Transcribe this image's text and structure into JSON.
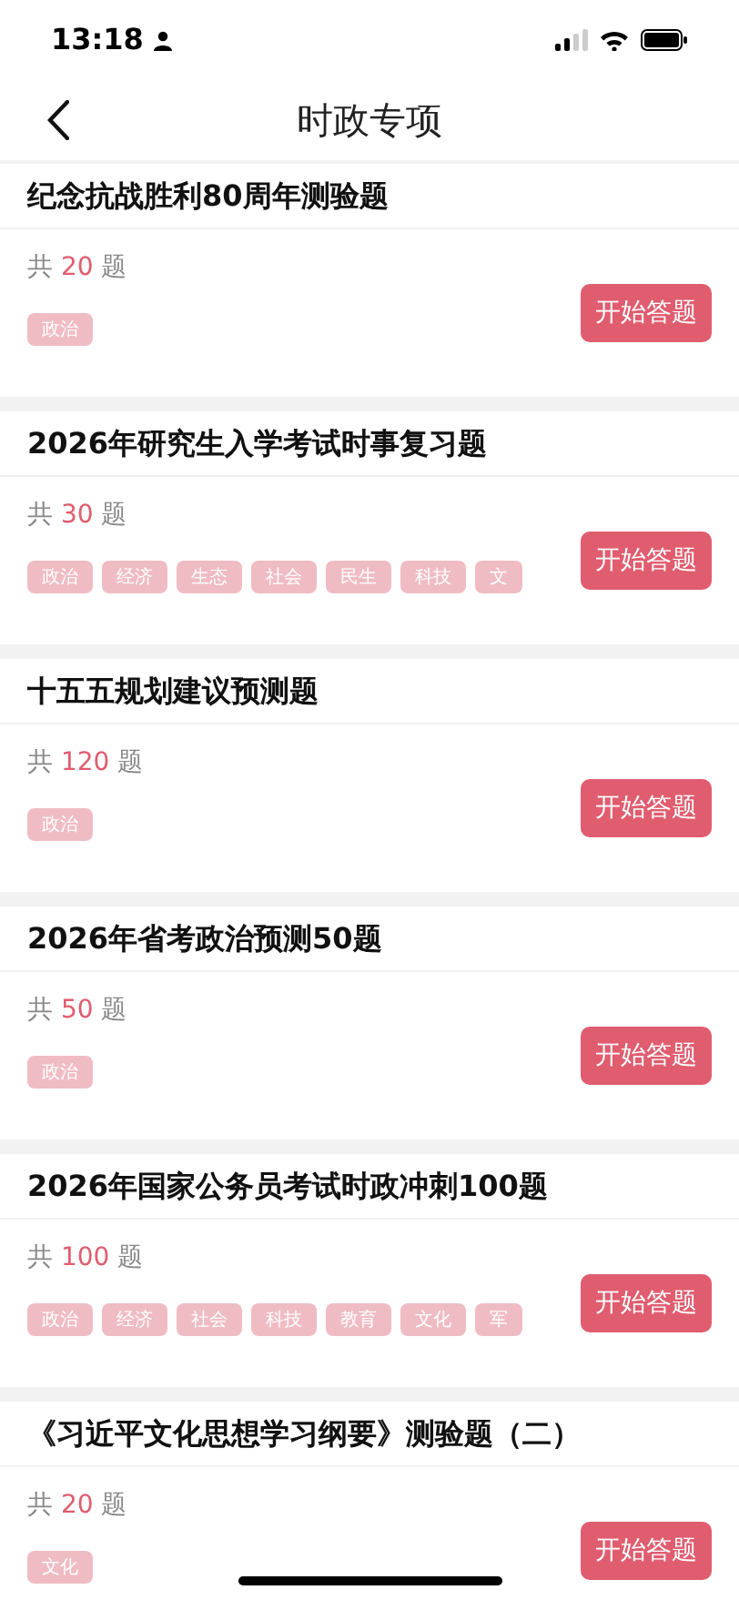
{
  "status_bar": {
    "time": "13:18"
  },
  "nav": {
    "title": "时政专项"
  },
  "quizzes": [
    {
      "title": "纪念抗战胜利80周年测验题",
      "count_prefix": "共",
      "count": "20",
      "count_suffix": "题",
      "tags": [
        "政治"
      ],
      "button": "开始答题"
    },
    {
      "title": "2026年研究生入学考试时事复习题",
      "count_prefix": "共",
      "count": "30",
      "count_suffix": "题",
      "tags": [
        "政治",
        "经济",
        "生态",
        "社会",
        "民生",
        "科技",
        "文"
      ],
      "button": "开始答题"
    },
    {
      "title": "十五五规划建议预测题",
      "count_prefix": "共",
      "count": "120",
      "count_suffix": "题",
      "tags": [
        "政治"
      ],
      "button": "开始答题"
    },
    {
      "title": "2026年省考政治预测50题",
      "count_prefix": "共",
      "count": "50",
      "count_suffix": "题",
      "tags": [
        "政治"
      ],
      "button": "开始答题"
    },
    {
      "title": "2026年国家公务员考试时政冲刺100题",
      "count_prefix": "共",
      "count": "100",
      "count_suffix": "题",
      "tags": [
        "政治",
        "经济",
        "社会",
        "科技",
        "教育",
        "文化",
        "军"
      ],
      "button": "开始答题"
    },
    {
      "title": "《习近平文化思想学习纲要》测验题（二）",
      "count_prefix": "共",
      "count": "20",
      "count_suffix": "题",
      "tags": [
        "文化"
      ],
      "button": "开始答题"
    }
  ]
}
